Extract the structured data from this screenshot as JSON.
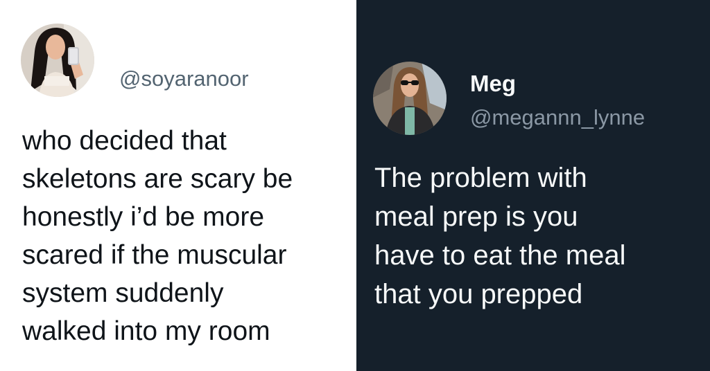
{
  "left_tweet": {
    "handle": "@soyaranoor",
    "lines": [
      "who decided that",
      "skeletons are scary be",
      "honestly i’d be more",
      "scared if the muscular",
      "system suddenly",
      "walked into my room"
    ]
  },
  "right_tweet": {
    "display_name": "Meg",
    "handle": "@megannn_lynne",
    "lines": [
      "The problem with",
      "meal prep is you",
      "have to eat the meal",
      "that you prepped"
    ]
  },
  "colors": {
    "left_background": "#ffffff",
    "right_background": "#15202b",
    "left_text": "#0f1419",
    "left_handle": "#536471",
    "right_text": "#f7f9f9",
    "right_handle": "#8b98a5"
  }
}
